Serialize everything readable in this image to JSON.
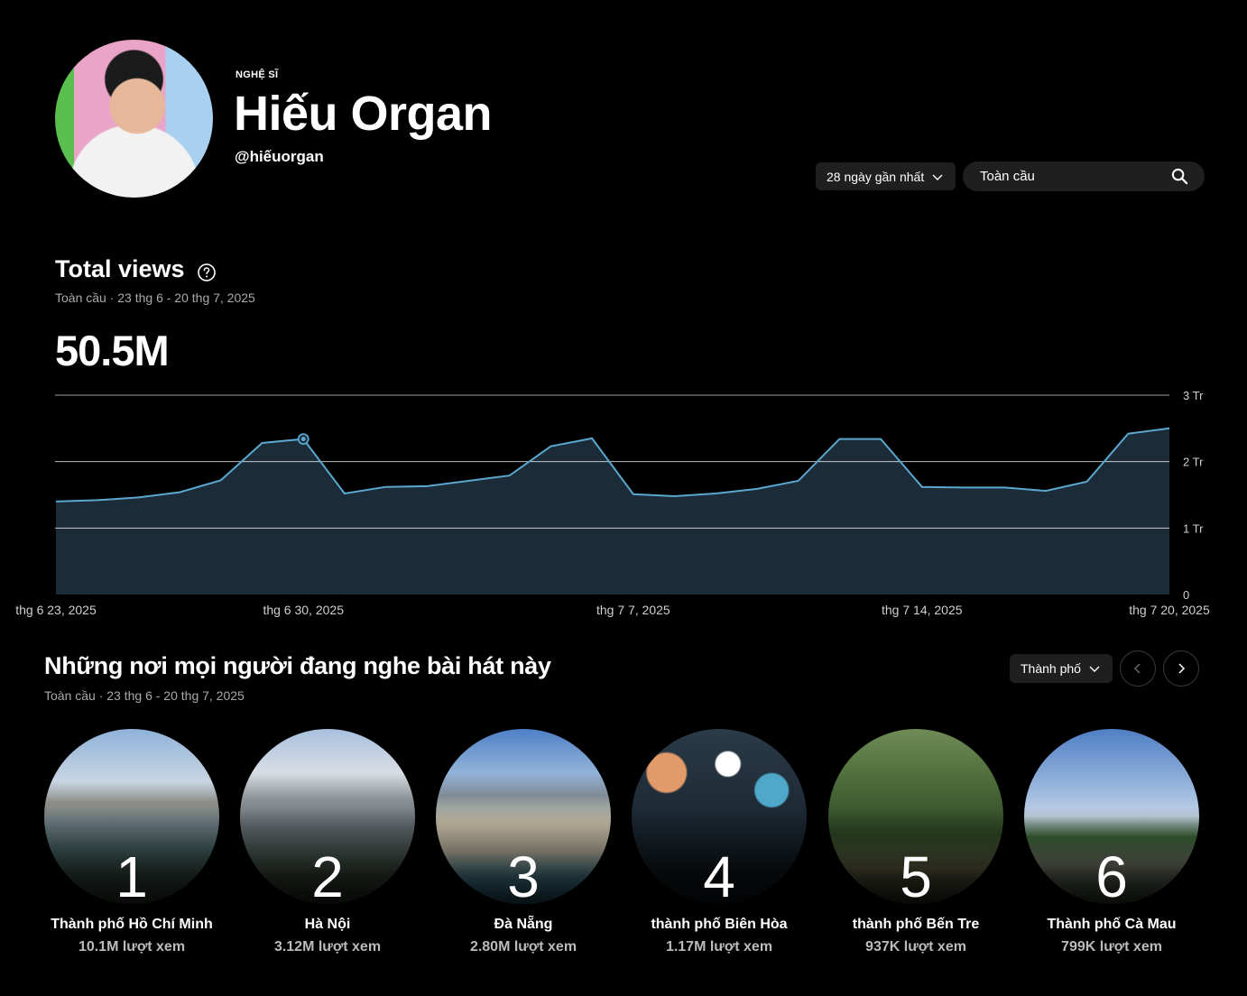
{
  "header": {
    "label": "NGHỆ SĨ",
    "artist_name": "Hiếu Organ",
    "handle": "@hiếuorgan"
  },
  "controls": {
    "range": "28 ngày gần nhất",
    "search_placeholder": "Toàn cầu"
  },
  "total_views": {
    "title": "Total views",
    "subtitle": "Toàn cầu · 23 thg 6 - 20 thg 7, 2025",
    "value": "50.5M"
  },
  "chart_data": {
    "type": "area",
    "x": [
      "2025-06-23",
      "2025-06-24",
      "2025-06-25",
      "2025-06-26",
      "2025-06-27",
      "2025-06-28",
      "2025-06-29",
      "2025-06-30",
      "2025-07-01",
      "2025-07-02",
      "2025-07-03",
      "2025-07-04",
      "2025-07-05",
      "2025-07-06",
      "2025-07-07",
      "2025-07-08",
      "2025-07-09",
      "2025-07-10",
      "2025-07-11",
      "2025-07-12",
      "2025-07-13",
      "2025-07-14",
      "2025-07-15",
      "2025-07-16",
      "2025-07-17",
      "2025-07-18",
      "2025-07-19",
      "2025-07-20"
    ],
    "values": [
      1.4,
      1.42,
      1.46,
      1.54,
      1.72,
      2.28,
      2.34,
      1.52,
      1.62,
      1.63,
      1.71,
      1.79,
      2.23,
      2.35,
      1.51,
      1.48,
      1.52,
      1.59,
      1.71,
      2.34,
      2.34,
      1.62,
      1.61,
      1.61,
      1.56,
      1.7,
      2.42,
      2.5
    ],
    "xtick_labels": [
      "thg 6 23, 2025",
      "thg 6 30, 2025",
      "thg 7 7, 2025",
      "thg 7 14, 2025",
      "thg 7 20, 2025"
    ],
    "xtick_index": [
      0,
      6,
      14,
      21,
      27
    ],
    "ytick_labels": [
      "0",
      "1 Tr",
      "2 Tr",
      "3 Tr"
    ],
    "ytick_values": [
      0,
      1,
      2,
      3
    ],
    "ylim": [
      0,
      3
    ],
    "highlight_index": 6,
    "grid": true,
    "colors": {
      "line": "#5ba7cf",
      "fill": "#1b2c38",
      "grid": "#ffffff"
    }
  },
  "places": {
    "title": "Những nơi mọi người đang nghe bài hát này",
    "subtitle": "Toàn cầu · 23 thg 6 - 20 thg 7, 2025",
    "filter": "Thành phố",
    "items": [
      {
        "rank": "1",
        "city": "Thành phố Hồ Chí Minh",
        "views": "10.1M lượt xem"
      },
      {
        "rank": "2",
        "city": "Hà Nội",
        "views": "3.12M lượt xem"
      },
      {
        "rank": "3",
        "city": "Đà Nẵng",
        "views": "2.80M lượt xem"
      },
      {
        "rank": "4",
        "city": "thành phố Biên Hòa",
        "views": "1.17M lượt xem"
      },
      {
        "rank": "5",
        "city": "thành phố Bến Tre",
        "views": "937K lượt xem"
      },
      {
        "rank": "6",
        "city": "Thành phố Cà Mau",
        "views": "799K lượt xem"
      }
    ]
  }
}
